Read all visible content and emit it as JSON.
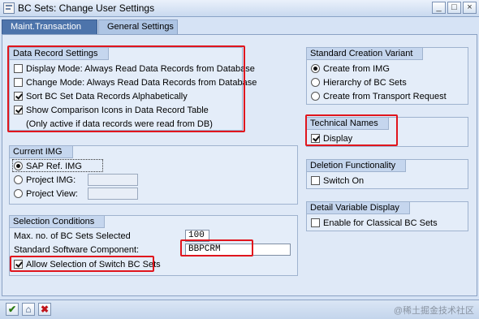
{
  "window": {
    "title": "BC Sets: Change User Settings"
  },
  "tabs": [
    {
      "label": "Maint.Transaction",
      "active": true
    },
    {
      "label": "General Settings",
      "active": false
    }
  ],
  "data_record_settings": {
    "title": "Data Record Settings",
    "options": [
      {
        "label": "Display Mode: Always Read Data Records from Database",
        "checked": false
      },
      {
        "label": "Change Mode: Always Read Data Records from Database",
        "checked": false
      },
      {
        "label": "Sort BC Set Data Records Alphabetically",
        "checked": true
      },
      {
        "label": "Show Comparison Icons in Data Record Table",
        "checked": true
      }
    ],
    "note": "(Only active if data records were read from DB)"
  },
  "current_img": {
    "title": "Current IMG",
    "options": [
      {
        "label": "SAP Ref. IMG",
        "selected": true
      },
      {
        "label": "Project IMG:",
        "selected": false
      },
      {
        "label": "Project View:",
        "selected": false
      }
    ]
  },
  "selection_conditions": {
    "title": "Selection Conditions",
    "max_label": "Max. no. of BC Sets Selected",
    "max_value": "100",
    "component_label": "Standard Software Component:",
    "component_value": "BBPCRM",
    "switch_label": "Allow Selection of Switch BC Sets",
    "switch_checked": true
  },
  "standard_creation_variant": {
    "title": "Standard Creation Variant",
    "options": [
      {
        "label": "Create from IMG",
        "selected": true
      },
      {
        "label": "Hierarchy of BC Sets",
        "selected": false
      },
      {
        "label": "Create from Transport Request",
        "selected": false
      }
    ]
  },
  "technical_names": {
    "title": "Technical Names",
    "label": "Display",
    "checked": true
  },
  "deletion_functionality": {
    "title": "Deletion Functionality",
    "label": "Switch On",
    "checked": false
  },
  "detail_variable_display": {
    "title": "Detail Variable Display",
    "label": "Enable for Classical BC Sets",
    "checked": false
  },
  "watermark": "@稀土掘金技术社区",
  "colors": {
    "highlight": "#e0151d",
    "tab_active": "#4d74ab",
    "background": "#dfe9f7"
  },
  "icons": {
    "confirm": "checkmark-icon",
    "save": "save-icon",
    "cancel": "cancel-icon",
    "minimize": "minimize-icon",
    "maximize": "maximize-icon",
    "close": "close-icon"
  }
}
